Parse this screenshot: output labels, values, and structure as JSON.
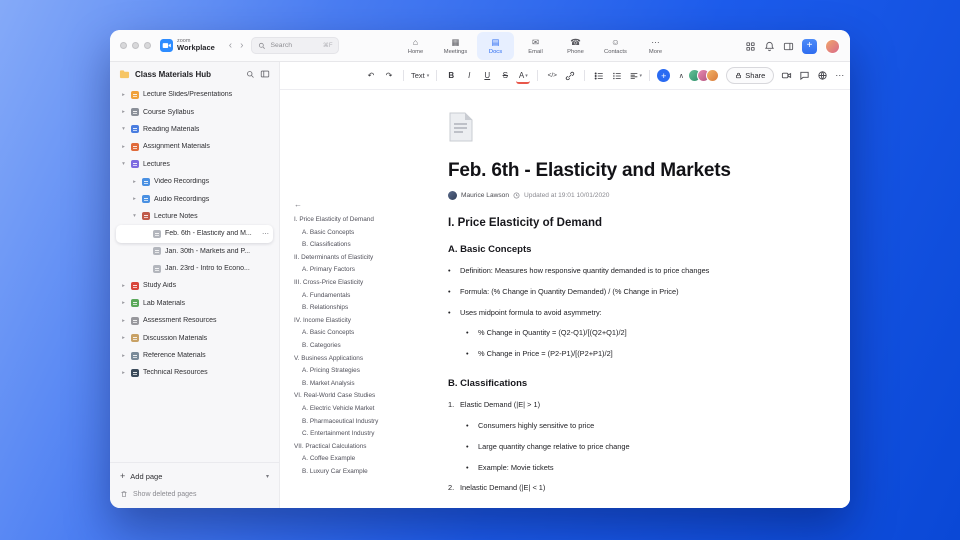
{
  "colors": {
    "accent": "#2a6bf2",
    "zoom_blue": "#2d8cff",
    "font_color_bar": "#e8574a"
  },
  "titlebar": {
    "brand_top": "zoom",
    "brand_bottom": "Workplace",
    "back": "‹",
    "forward": "›",
    "search": {
      "placeholder": "Search",
      "shortcut": "⌘F"
    },
    "tabs": [
      {
        "label": "Home",
        "icon": "home-icon",
        "glyph": "⌂"
      },
      {
        "label": "Meetings",
        "icon": "meetings-icon",
        "glyph": "▦"
      },
      {
        "label": "Docs",
        "icon": "docs-icon",
        "glyph": "▤",
        "active": true
      },
      {
        "label": "Email",
        "icon": "email-icon",
        "glyph": "✉"
      },
      {
        "label": "Phone",
        "icon": "phone-icon",
        "glyph": "☎"
      },
      {
        "label": "Contacts",
        "icon": "contacts-icon",
        "glyph": "☺"
      },
      {
        "label": "More",
        "icon": "more-icon",
        "glyph": "⋯"
      }
    ],
    "plus": "+"
  },
  "sidebar": {
    "title": "Class Materials Hub",
    "items": [
      {
        "label": "Lecture Slides/Presentations",
        "indent": 0,
        "chevron": "right",
        "color": "#f0a13a"
      },
      {
        "label": "Course Syllabus",
        "indent": 0,
        "chevron": "right",
        "color": "#8a8f98"
      },
      {
        "label": "Reading Materials",
        "indent": 0,
        "chevron": "down",
        "color": "#4a7de0"
      },
      {
        "label": "Assignment Materials",
        "indent": 0,
        "chevron": "right",
        "color": "#e06a3a"
      },
      {
        "label": "Lectures",
        "indent": 0,
        "chevron": "down",
        "color": "#7d6ae0"
      },
      {
        "label": "Video Recordings",
        "indent": 1,
        "chevron": "right",
        "color": "#4a90e2"
      },
      {
        "label": "Audio Recordings",
        "indent": 1,
        "chevron": "right",
        "color": "#4a90e2"
      },
      {
        "label": "Lecture Notes",
        "indent": 1,
        "chevron": "down",
        "color": "#c05a4a"
      },
      {
        "label": "Feb. 6th - Elasticity and M...",
        "indent": 2,
        "chevron": "none",
        "color": "#b3b6bd",
        "active": true
      },
      {
        "label": "Jan. 30th - Markets and P...",
        "indent": 2,
        "chevron": "none",
        "color": "#b3b6bd"
      },
      {
        "label": "Jan. 23rd - Intro to Econo...",
        "indent": 2,
        "chevron": "none",
        "color": "#b3b6bd"
      },
      {
        "label": "Study Aids",
        "indent": 0,
        "chevron": "right",
        "color": "#d9453a"
      },
      {
        "label": "Lab Materials",
        "indent": 0,
        "chevron": "right",
        "color": "#5aa85a"
      },
      {
        "label": "Assessment Resources",
        "indent": 0,
        "chevron": "right",
        "color": "#98989d"
      },
      {
        "label": "Discussion Materials",
        "indent": 0,
        "chevron": "right",
        "color": "#c8a165"
      },
      {
        "label": "Reference Materials",
        "indent": 0,
        "chevron": "right",
        "color": "#7a8a99"
      },
      {
        "label": "Technical Resources",
        "indent": 0,
        "chevron": "right",
        "color": "#3a4a5a"
      }
    ],
    "more": "⋯",
    "add_page": "Add page",
    "add_page_plus": "+",
    "add_page_caret": "▾",
    "show_deleted": "Show deleted pages"
  },
  "toolbar": {
    "undo": "↶",
    "redo": "↷",
    "text_style": "Text",
    "caret": "▾",
    "bold": "B",
    "italic": "I",
    "underline": "U",
    "strike": "S",
    "font_color": "A",
    "code": "</>",
    "insert": "+",
    "collapse": "∧",
    "share": "Share",
    "more": "⋯"
  },
  "outline": {
    "collapse_glyph": "←",
    "items": [
      {
        "label": "I. Price Elasticity of Demand",
        "indent": 0
      },
      {
        "label": "A. Basic Concepts",
        "indent": 1
      },
      {
        "label": "B. Classifications",
        "indent": 1
      },
      {
        "label": "II. Determinants of Elasticity",
        "indent": 0
      },
      {
        "label": "A. Primary Factors",
        "indent": 1
      },
      {
        "label": "III. Cross-Price Elasticity",
        "indent": 0
      },
      {
        "label": "A. Fundamentals",
        "indent": 1
      },
      {
        "label": "B. Relationships",
        "indent": 1
      },
      {
        "label": "IV. Income Elasticity",
        "indent": 0
      },
      {
        "label": "A. Basic Concepts",
        "indent": 1
      },
      {
        "label": "B. Categories",
        "indent": 1
      },
      {
        "label": "V. Business Applications",
        "indent": 0
      },
      {
        "label": "A. Pricing Strategies",
        "indent": 1
      },
      {
        "label": "B. Market Analysis",
        "indent": 1
      },
      {
        "label": "VI. Real-World Case Studies",
        "indent": 0
      },
      {
        "label": "A. Electric Vehicle Market",
        "indent": 1
      },
      {
        "label": "B. Pharmaceutical Industry",
        "indent": 1
      },
      {
        "label": "C. Entertainment Industry",
        "indent": 1
      },
      {
        "label": "VII. Practical Calculations",
        "indent": 0
      },
      {
        "label": "A. Coffee Example",
        "indent": 1
      },
      {
        "label": "B. Luxury Car Example",
        "indent": 1
      }
    ]
  },
  "document": {
    "title": "Feb. 6th - Elasticity and Markets",
    "author": "Maurice Lawson",
    "updated": "Updated at 19:01 10/01/2020",
    "heading1": "I. Price Elasticity of Demand",
    "headingA": "A. Basic Concepts",
    "listA": [
      {
        "marker": "•",
        "text": "Definition: Measures how responsive quantity demanded is to price changes",
        "indent": 0
      },
      {
        "marker": "•",
        "text": "Formula: (% Change in Quantity Demanded) / (% Change in Price)",
        "indent": 0
      },
      {
        "marker": "•",
        "text": "Uses midpoint formula to avoid asymmetry:",
        "indent": 0
      },
      {
        "marker": "•",
        "text": "% Change in Quantity = (Q2-Q1)/[(Q2+Q1)/2]",
        "indent": 1
      },
      {
        "marker": "•",
        "text": "% Change in Price = (P2-P1)/[(P2+P1)/2]",
        "indent": 1
      }
    ],
    "headingB": "B. Classifications",
    "listB": [
      {
        "marker": "1.",
        "text": "Elastic Demand (|E| > 1)",
        "indent": 0
      },
      {
        "marker": "•",
        "text": "Consumers highly sensitive to price",
        "indent": 1
      },
      {
        "marker": "•",
        "text": "Large quantity change relative to price change",
        "indent": 1
      },
      {
        "marker": "•",
        "text": "Example: Movie tickets",
        "indent": 1
      },
      {
        "marker": "2.",
        "text": "Inelastic Demand (|E| < 1)",
        "indent": 0
      }
    ]
  }
}
